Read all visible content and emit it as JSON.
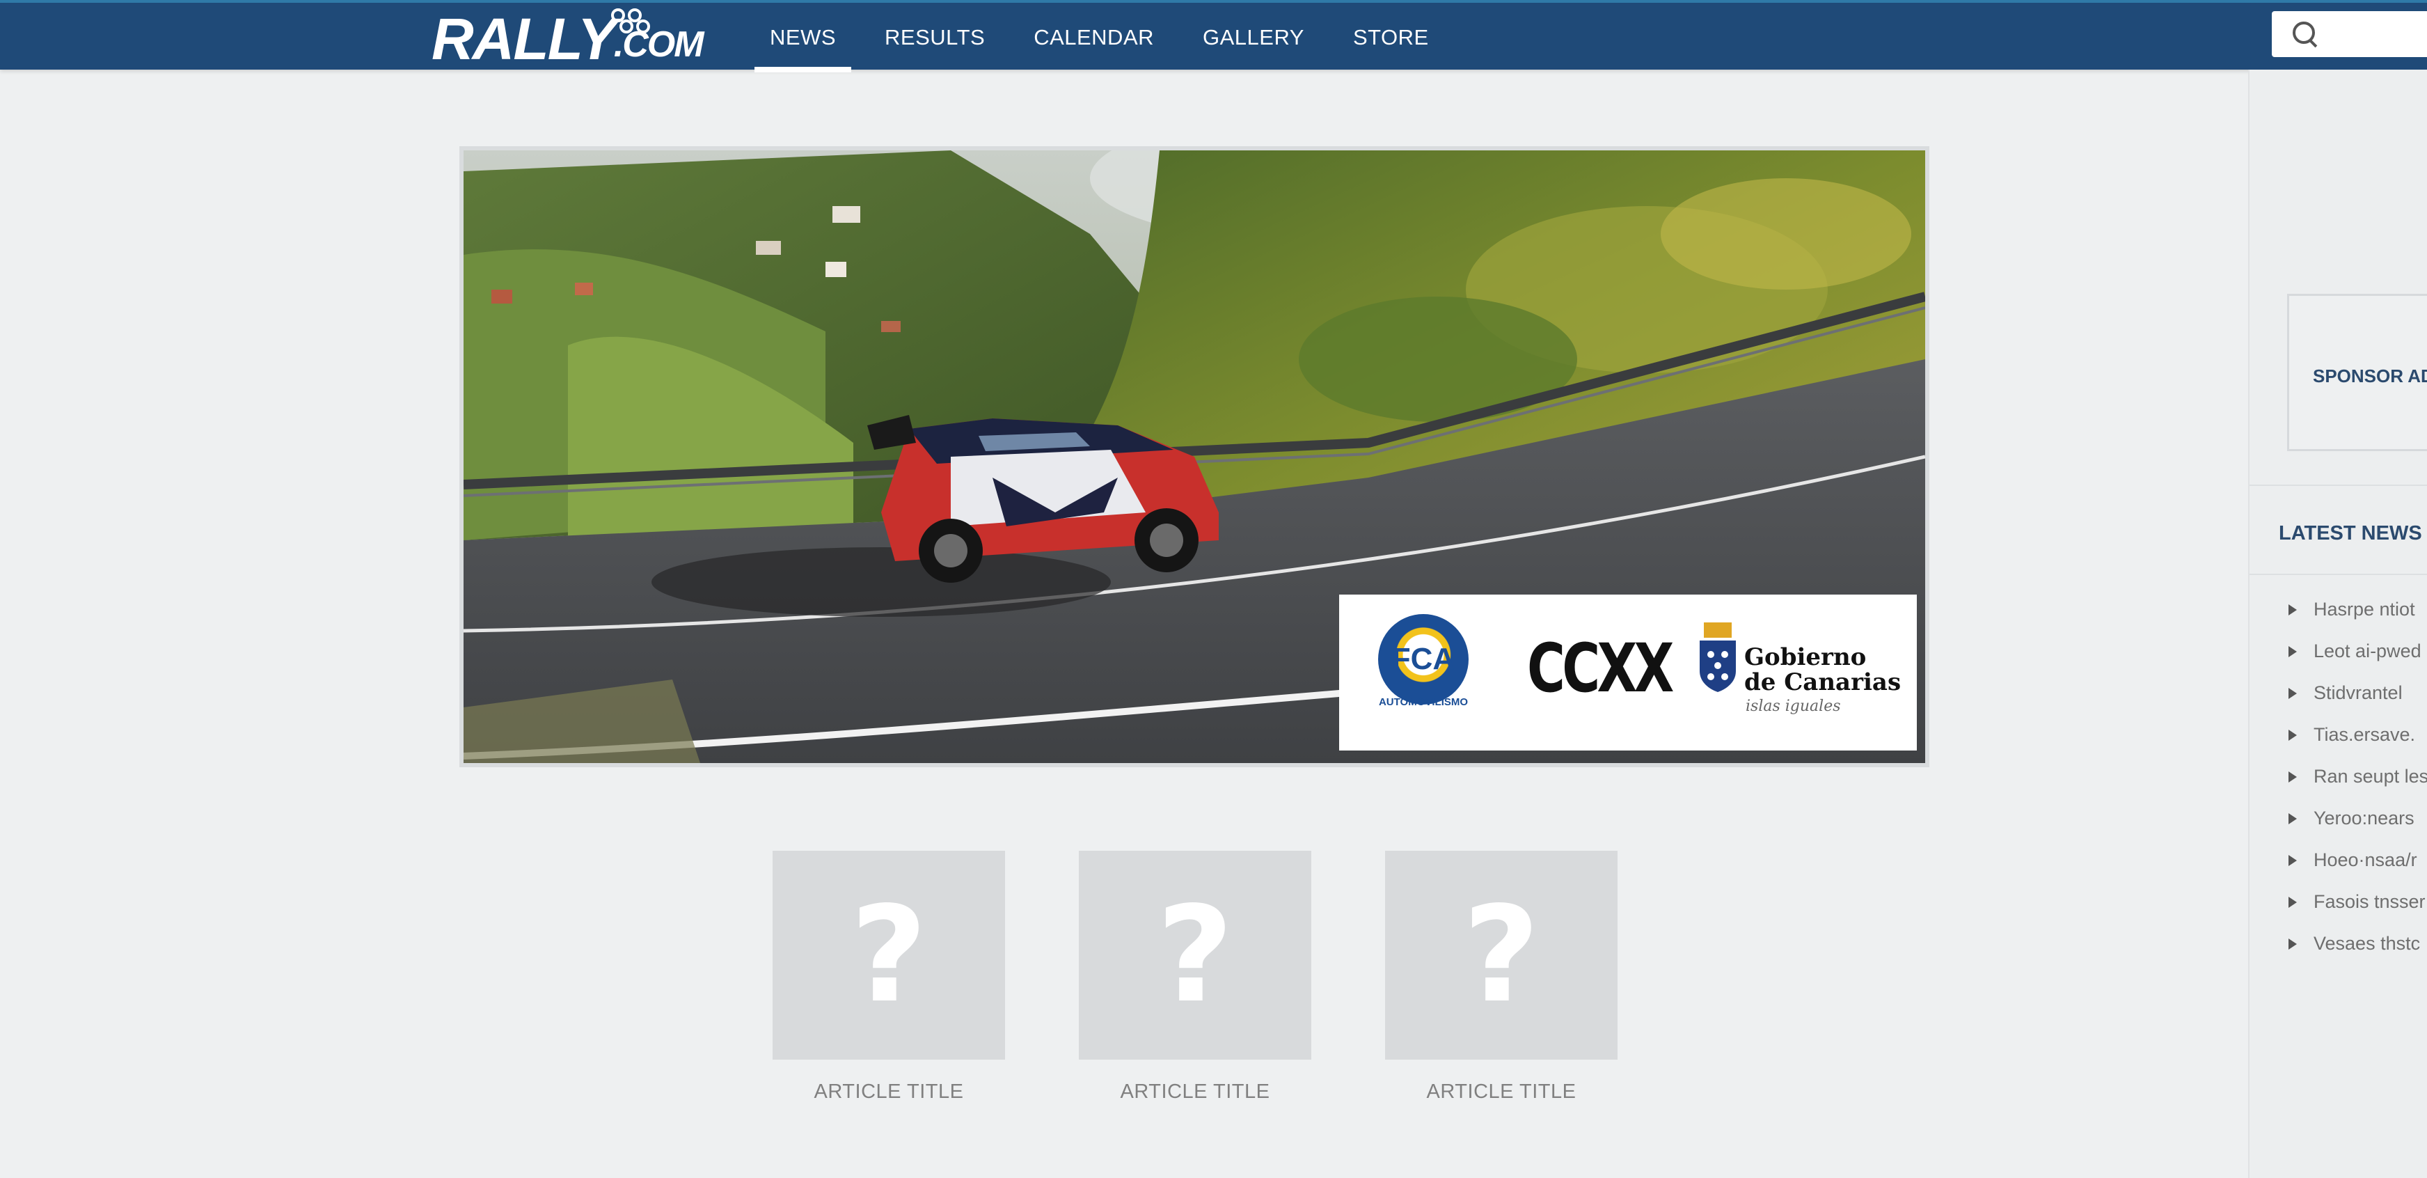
{
  "header": {
    "logo": {
      "main": "RALLY",
      "suffix": ".COM"
    },
    "nav": [
      {
        "label": "NEWS",
        "active": true
      },
      {
        "label": "RESULTS",
        "active": false
      },
      {
        "label": "CALENDAR",
        "active": false
      },
      {
        "label": "GALLERY",
        "active": false
      },
      {
        "label": "STORE",
        "active": false
      }
    ],
    "search": {
      "placeholder": "",
      "icon": "search-icon"
    }
  },
  "hero": {
    "sponsors": {
      "fca": {
        "badge": "FCA",
        "sub": "AUTOMOVILISMO"
      },
      "ccxx": "CCXX",
      "gobierno": {
        "line1": "Gobierno",
        "line2": "de Canarias",
        "line3": "islas iguales"
      }
    }
  },
  "articles": [
    {
      "title": "ARTICLE TITLE",
      "thumb": "?"
    },
    {
      "title": "ARTICLE TITLE",
      "thumb": "?"
    },
    {
      "title": "ARTICLE TITLE",
      "thumb": "?"
    }
  ],
  "sidebar": {
    "sponsor_label": "SPONSOR AD",
    "latest_title": "LATEST NEWS",
    "latest": [
      "Hasrpe ntiot",
      "Leot ai-pwed",
      "Stidvrantel",
      "Tias.ersave.",
      "Ran seupt les",
      "Yeroo:nears",
      "Hoeo·nsaa/r",
      "Fasois tnsser",
      "Vesaes thstc"
    ]
  },
  "colors": {
    "nav_bg": "#1f4a78",
    "page_bg": "#eef0f1",
    "heading": "#2b4a6e"
  }
}
